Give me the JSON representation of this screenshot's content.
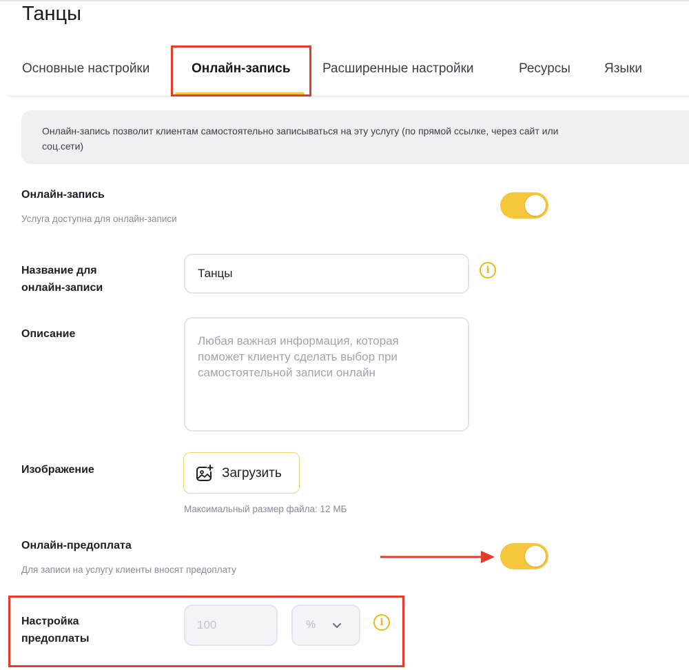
{
  "page": {
    "title": "Танцы"
  },
  "tabs": [
    {
      "label": "Основные настройки",
      "active": false
    },
    {
      "label": "Онлайн-запись",
      "active": true
    },
    {
      "label": "Расширенные настройки",
      "active": false
    },
    {
      "label": "Ресурсы",
      "active": false
    },
    {
      "label": "Языки",
      "active": false
    }
  ],
  "info": {
    "line1": "Онлайн-запись позволит клиентам самостоятельно записываться на эту услугу (по прямой ссылке, через сайт или",
    "line2": "соц.сети)"
  },
  "online_booking": {
    "label": "Онлайн-запись",
    "hint": "Услуга доступна для онлайн-записи",
    "enabled": true
  },
  "booking_name": {
    "label_line1": "Название для",
    "label_line2": "онлайн-записи",
    "value": "Танцы"
  },
  "description": {
    "label": "Описание",
    "placeholder_line1": "Любая важная информация, которая",
    "placeholder_line2": "поможет клиенту сделать выбор при",
    "placeholder_line3": "самостоятельной записи онлайн"
  },
  "image": {
    "label": "Изображение",
    "upload_label": "Загрузить",
    "max_size_hint": "Максимальный размер файла: 12 МБ"
  },
  "online_prepayment": {
    "label": "Онлайн-предоплата",
    "hint": "Для записи на услугу клиенты вносят предоплату",
    "enabled": true
  },
  "prepayment_settings": {
    "label_line1": "Настройка",
    "label_line2": "предоплаты",
    "amount_placeholder": "100",
    "unit_selected": "%"
  },
  "colors": {
    "accent": "#f6c63b",
    "highlight_red": "#e33b2a",
    "info_bg": "#eff0f4"
  }
}
